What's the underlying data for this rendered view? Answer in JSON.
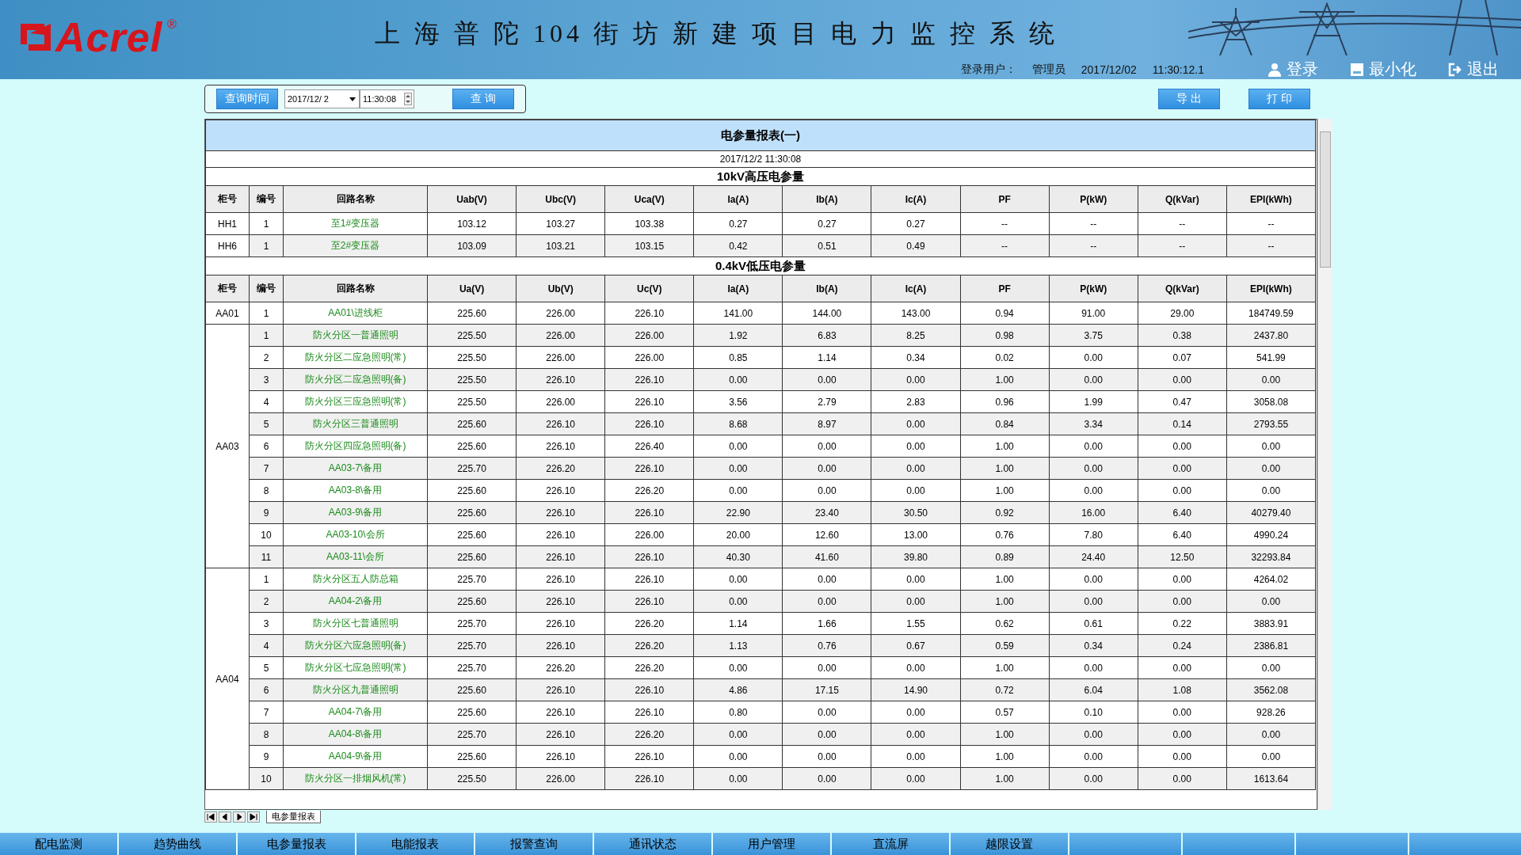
{
  "header": {
    "logo": "Acrel",
    "logo_mark": "®",
    "title": "上 海 普 陀 104 街 坊 新 建 项 目 电 力 监 控 系 统",
    "user_label": "登录用户：",
    "user": "管理员",
    "date": "2017/12/02",
    "time": "11:30:12.1",
    "actions": [
      {
        "kind": "login",
        "label": "登录"
      },
      {
        "kind": "minimize",
        "label": "最小化"
      },
      {
        "kind": "exit",
        "label": "退出"
      }
    ]
  },
  "toolbar": {
    "query_time_button": "查询时间",
    "date_value": "2017/12/ 2",
    "time_value": "11:30:08",
    "query_button": "查 询",
    "export_button": "导 出",
    "print_button": "打 印"
  },
  "report": {
    "title": "电参量报表(一)",
    "timestamp": "2017/12/2 11:30:08",
    "sections": [
      {
        "title": "10kV高压电参量",
        "columns": [
          "柜号",
          "编号",
          "回路名称",
          "Uab(V)",
          "Ubc(V)",
          "Uca(V)",
          "Ia(A)",
          "Ib(A)",
          "Ic(A)",
          "PF",
          "P(kW)",
          "Q(kVar)",
          "EPI(kWh)"
        ],
        "groups": [
          {
            "cabinet": "HH1",
            "rows": [
              {
                "no": "1",
                "name": "至1#变压器",
                "values": [
                  "103.12",
                  "103.27",
                  "103.38",
                  "0.27",
                  "0.27",
                  "0.27",
                  "--",
                  "--",
                  "--",
                  "--"
                ]
              }
            ]
          },
          {
            "cabinet": "HH6",
            "rows": [
              {
                "no": "1",
                "name": "至2#变压器",
                "values": [
                  "103.09",
                  "103.21",
                  "103.15",
                  "0.42",
                  "0.51",
                  "0.49",
                  "--",
                  "--",
                  "--",
                  "--"
                ]
              }
            ]
          }
        ]
      },
      {
        "title": "0.4kV低压电参量",
        "columns": [
          "柜号",
          "编号",
          "回路名称",
          "Ua(V)",
          "Ub(V)",
          "Uc(V)",
          "Ia(A)",
          "Ib(A)",
          "Ic(A)",
          "PF",
          "P(kW)",
          "Q(kVar)",
          "EPI(kWh)"
        ],
        "groups": [
          {
            "cabinet": "AA01",
            "rows": [
              {
                "no": "1",
                "name": "AA01\\进线柜",
                "values": [
                  "225.60",
                  "226.00",
                  "226.10",
                  "141.00",
                  "144.00",
                  "143.00",
                  "0.94",
                  "91.00",
                  "29.00",
                  "184749.59"
                ]
              }
            ]
          },
          {
            "cabinet": "AA03",
            "rows": [
              {
                "no": "1",
                "name": "防火分区一普通照明",
                "values": [
                  "225.50",
                  "226.00",
                  "226.00",
                  "1.92",
                  "6.83",
                  "8.25",
                  "0.98",
                  "3.75",
                  "0.38",
                  "2437.80"
                ]
              },
              {
                "no": "2",
                "name": "防火分区二应急照明(常)",
                "values": [
                  "225.50",
                  "226.00",
                  "226.00",
                  "0.85",
                  "1.14",
                  "0.34",
                  "0.02",
                  "0.00",
                  "0.07",
                  "541.99"
                ]
              },
              {
                "no": "3",
                "name": "防火分区二应急照明(备)",
                "values": [
                  "225.50",
                  "226.10",
                  "226.10",
                  "0.00",
                  "0.00",
                  "0.00",
                  "1.00",
                  "0.00",
                  "0.00",
                  "0.00"
                ]
              },
              {
                "no": "4",
                "name": "防火分区三应急照明(常)",
                "values": [
                  "225.50",
                  "226.00",
                  "226.10",
                  "3.56",
                  "2.79",
                  "2.83",
                  "0.96",
                  "1.99",
                  "0.47",
                  "3058.08"
                ]
              },
              {
                "no": "5",
                "name": "防火分区三普通照明",
                "values": [
                  "225.60",
                  "226.10",
                  "226.10",
                  "8.68",
                  "8.97",
                  "0.00",
                  "0.84",
                  "3.34",
                  "0.14",
                  "2793.55"
                ]
              },
              {
                "no": "6",
                "name": "防火分区四应急照明(备)",
                "values": [
                  "225.60",
                  "226.10",
                  "226.40",
                  "0.00",
                  "0.00",
                  "0.00",
                  "1.00",
                  "0.00",
                  "0.00",
                  "0.00"
                ]
              },
              {
                "no": "7",
                "name": "AA03-7\\备用",
                "values": [
                  "225.70",
                  "226.20",
                  "226.10",
                  "0.00",
                  "0.00",
                  "0.00",
                  "1.00",
                  "0.00",
                  "0.00",
                  "0.00"
                ]
              },
              {
                "no": "8",
                "name": "AA03-8\\备用",
                "values": [
                  "225.60",
                  "226.10",
                  "226.20",
                  "0.00",
                  "0.00",
                  "0.00",
                  "1.00",
                  "0.00",
                  "0.00",
                  "0.00"
                ]
              },
              {
                "no": "9",
                "name": "AA03-9\\备用",
                "values": [
                  "225.60",
                  "226.10",
                  "226.10",
                  "22.90",
                  "23.40",
                  "30.50",
                  "0.92",
                  "16.00",
                  "6.40",
                  "40279.40"
                ]
              },
              {
                "no": "10",
                "name": "AA03-10\\会所",
                "values": [
                  "225.60",
                  "226.10",
                  "226.00",
                  "20.00",
                  "12.60",
                  "13.00",
                  "0.76",
                  "7.80",
                  "6.40",
                  "4990.24"
                ]
              },
              {
                "no": "11",
                "name": "AA03-11\\会所",
                "values": [
                  "225.60",
                  "226.10",
                  "226.10",
                  "40.30",
                  "41.60",
                  "39.80",
                  "0.89",
                  "24.40",
                  "12.50",
                  "32293.84"
                ]
              }
            ]
          },
          {
            "cabinet": "AA04",
            "rows": [
              {
                "no": "1",
                "name": "防火分区五人防总箱",
                "values": [
                  "225.70",
                  "226.10",
                  "226.10",
                  "0.00",
                  "0.00",
                  "0.00",
                  "1.00",
                  "0.00",
                  "0.00",
                  "4264.02"
                ]
              },
              {
                "no": "2",
                "name": "AA04-2\\备用",
                "values": [
                  "225.60",
                  "226.10",
                  "226.10",
                  "0.00",
                  "0.00",
                  "0.00",
                  "1.00",
                  "0.00",
                  "0.00",
                  "0.00"
                ]
              },
              {
                "no": "3",
                "name": "防火分区七普通照明",
                "values": [
                  "225.70",
                  "226.10",
                  "226.20",
                  "1.14",
                  "1.66",
                  "1.55",
                  "0.62",
                  "0.61",
                  "0.22",
                  "3883.91"
                ]
              },
              {
                "no": "4",
                "name": "防火分区六应急照明(备)",
                "values": [
                  "225.70",
                  "226.10",
                  "226.20",
                  "1.13",
                  "0.76",
                  "0.67",
                  "0.59",
                  "0.34",
                  "0.24",
                  "2386.81"
                ]
              },
              {
                "no": "5",
                "name": "防火分区七应急照明(常)",
                "values": [
                  "225.70",
                  "226.20",
                  "226.20",
                  "0.00",
                  "0.00",
                  "0.00",
                  "1.00",
                  "0.00",
                  "0.00",
                  "0.00"
                ]
              },
              {
                "no": "6",
                "name": "防火分区九普通照明",
                "values": [
                  "225.60",
                  "226.10",
                  "226.10",
                  "4.86",
                  "17.15",
                  "14.90",
                  "0.72",
                  "6.04",
                  "1.08",
                  "3562.08"
                ]
              },
              {
                "no": "7",
                "name": "AA04-7\\备用",
                "values": [
                  "225.60",
                  "226.10",
                  "226.10",
                  "0.80",
                  "0.00",
                  "0.00",
                  "0.57",
                  "0.10",
                  "0.00",
                  "928.26"
                ]
              },
              {
                "no": "8",
                "name": "AA04-8\\备用",
                "values": [
                  "225.70",
                  "226.10",
                  "226.20",
                  "0.00",
                  "0.00",
                  "0.00",
                  "1.00",
                  "0.00",
                  "0.00",
                  "0.00"
                ]
              },
              {
                "no": "9",
                "name": "AA04-9\\备用",
                "values": [
                  "225.60",
                  "226.10",
                  "226.10",
                  "0.00",
                  "0.00",
                  "0.00",
                  "1.00",
                  "0.00",
                  "0.00",
                  "0.00"
                ]
              },
              {
                "no": "10",
                "name": "防火分区一排烟风机(常)",
                "values": [
                  "225.50",
                  "226.00",
                  "226.10",
                  "0.00",
                  "0.00",
                  "0.00",
                  "1.00",
                  "0.00",
                  "0.00",
                  "1613.64"
                ]
              }
            ]
          }
        ]
      }
    ]
  },
  "sheet_tab": "电参量报表",
  "nav": [
    "配电监测",
    "趋势曲线",
    "电参量报表",
    "电能报表",
    "报警查询",
    "通讯状态",
    "用户管理",
    "直流屏",
    "越限设置"
  ]
}
